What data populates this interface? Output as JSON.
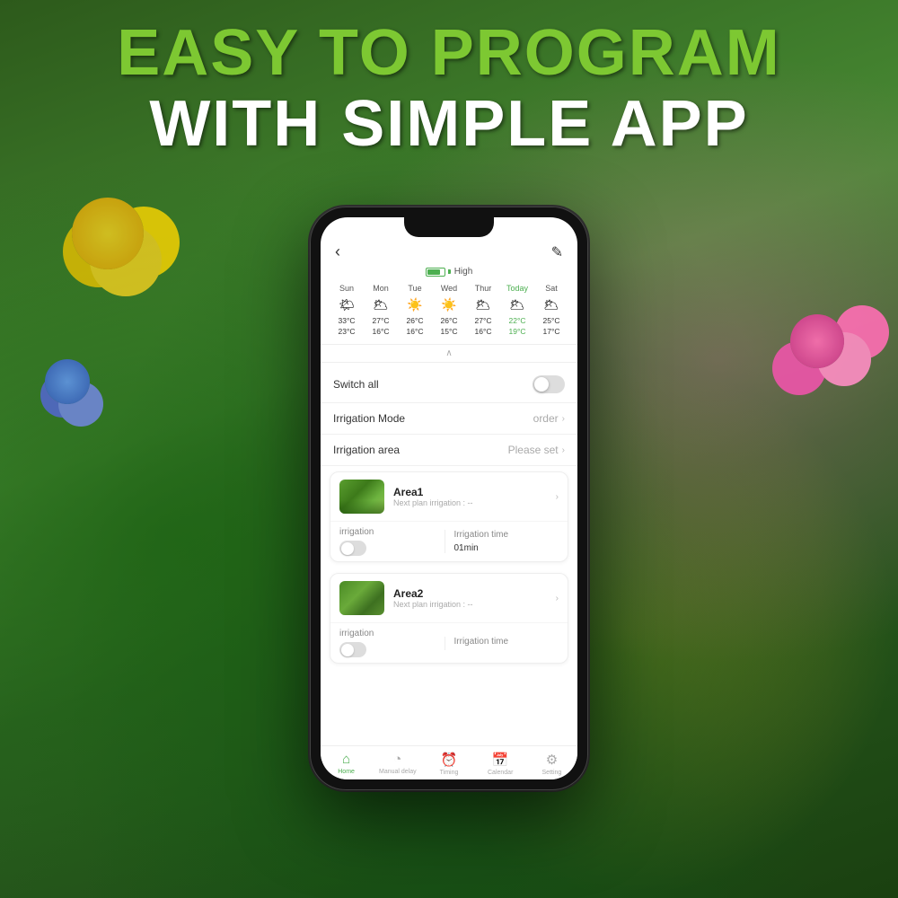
{
  "headline": {
    "line1": "EASY TO PROGRAM",
    "line2": "WITH SIMPLE APP"
  },
  "phone": {
    "battery": "High",
    "weather": {
      "days": [
        "Sun",
        "Mon",
        "Tue",
        "Wed",
        "Thur",
        "Today",
        "Sat"
      ],
      "icons": [
        "☁️",
        "☁️",
        "☀️",
        "☀️",
        "☁️",
        "☁️",
        "☁️"
      ],
      "high_temps": [
        "33°C",
        "27°C",
        "26°C",
        "26°C",
        "27°C",
        "22°C",
        "25°C"
      ],
      "low_temps": [
        "23°C",
        "16°C",
        "16°C",
        "15°C",
        "16°C",
        "19°C",
        "17°C"
      ]
    },
    "switch_all_label": "Switch all",
    "irrigation_mode_label": "Irrigation Mode",
    "irrigation_mode_value": "order",
    "irrigation_area_label": "Irrigation area",
    "irrigation_area_value": "Please set",
    "areas": [
      {
        "name": "Area1",
        "next_plan": "Next plan irrigation : --",
        "irrigation_label": "irrigation",
        "irrigation_time_label": "Irrigation time",
        "irrigation_time_value": "01min"
      },
      {
        "name": "Area2",
        "next_plan": "Next plan irrigation : --",
        "irrigation_label": "irrigation",
        "irrigation_time_label": "Irrigation time",
        "irrigation_time_value": ""
      }
    ],
    "nav": [
      {
        "icon": "🏠",
        "label": "Home",
        "active": true
      },
      {
        "icon": "⏱",
        "label": "Manual delay",
        "active": false
      },
      {
        "icon": "⏰",
        "label": "Timing",
        "active": false
      },
      {
        "icon": "📅",
        "label": "Calendar",
        "active": false
      },
      {
        "icon": "⚙️",
        "label": "Setting",
        "active": false
      }
    ]
  }
}
